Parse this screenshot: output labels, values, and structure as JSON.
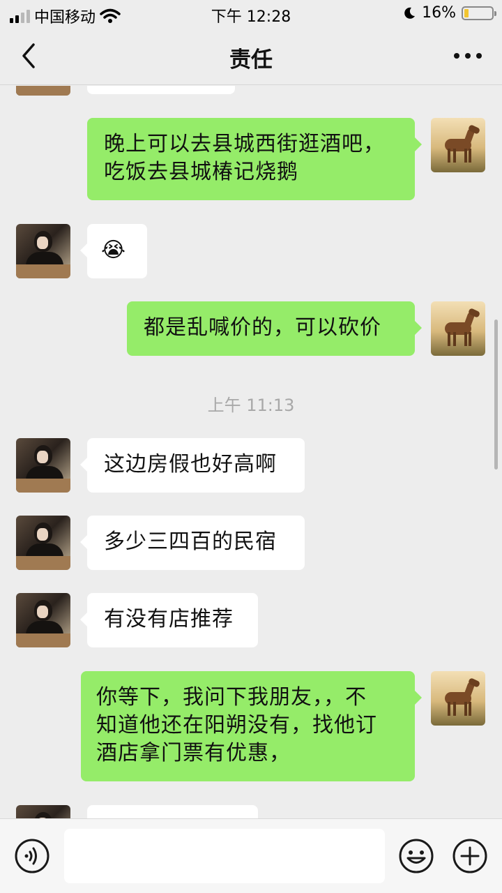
{
  "status_bar": {
    "carrier": "中国移动",
    "time": "下午 12:28",
    "battery_percent": "16%",
    "battery_color": "#f2c530",
    "icons": [
      "signal-icon",
      "wifi-icon",
      "moon-icon",
      "battery-icon"
    ]
  },
  "nav": {
    "title": "责任",
    "back_icon": "chevron-left-icon",
    "more_icon": "more-dots-icon"
  },
  "colors": {
    "background": "#ededed",
    "bubble_in": "#ffffff",
    "bubble_out": "#95ec69",
    "timestamp": "#a8a8a8"
  },
  "messages": [
    {
      "side": "out",
      "text": "晚上可以去县城西街逛酒吧，\n吃饭去县城椿记烧鹅"
    },
    {
      "side": "in",
      "text": "😭"
    },
    {
      "side": "out",
      "text": "都是乱喊价的，可以砍价"
    },
    {
      "timestamp": "上午 11:13"
    },
    {
      "side": "in",
      "text": "这边房假也好高啊"
    },
    {
      "side": "in",
      "text": "多少三四百的民宿"
    },
    {
      "side": "in",
      "text": "有没有店推荐"
    },
    {
      "side": "out",
      "text": "你等下，我问下我朋友，，不\n知道他还在阳朔没有，找他订\n酒店拿门票有优惠，"
    }
  ],
  "input_bar": {
    "placeholder": "",
    "icons": [
      "voice-icon",
      "emoji-icon",
      "plus-icon"
    ]
  }
}
